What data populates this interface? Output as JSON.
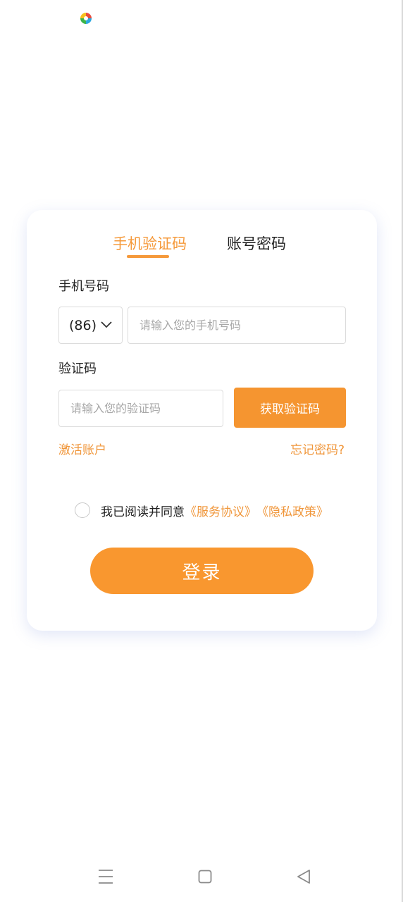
{
  "status_bar": {
    "app_icon": "colorful-pinwheel-icon"
  },
  "tabs": [
    {
      "label": "手机验证码",
      "active": true
    },
    {
      "label": "账号密码",
      "active": false
    }
  ],
  "phone_section": {
    "label": "手机号码",
    "country_code": "(86)",
    "country_icon": "chevron-down-icon",
    "phone_placeholder": "请输入您的手机号码"
  },
  "code_section": {
    "label": "验证码",
    "code_placeholder": "请输入您的验证码",
    "get_code_label": "获取验证码"
  },
  "links": {
    "activate": "激活账户",
    "forgot": "忘记密码?"
  },
  "agreement": {
    "prefix": "我已阅读并同意",
    "service": "《服务协议》",
    "privacy": "《隐私政策》",
    "checked": false
  },
  "login_label": "登录",
  "colors": {
    "accent": "#f5993a",
    "button": "#f9972f"
  },
  "nav_bar": {
    "icons": [
      "menu-icon",
      "home-icon",
      "back-icon"
    ]
  }
}
